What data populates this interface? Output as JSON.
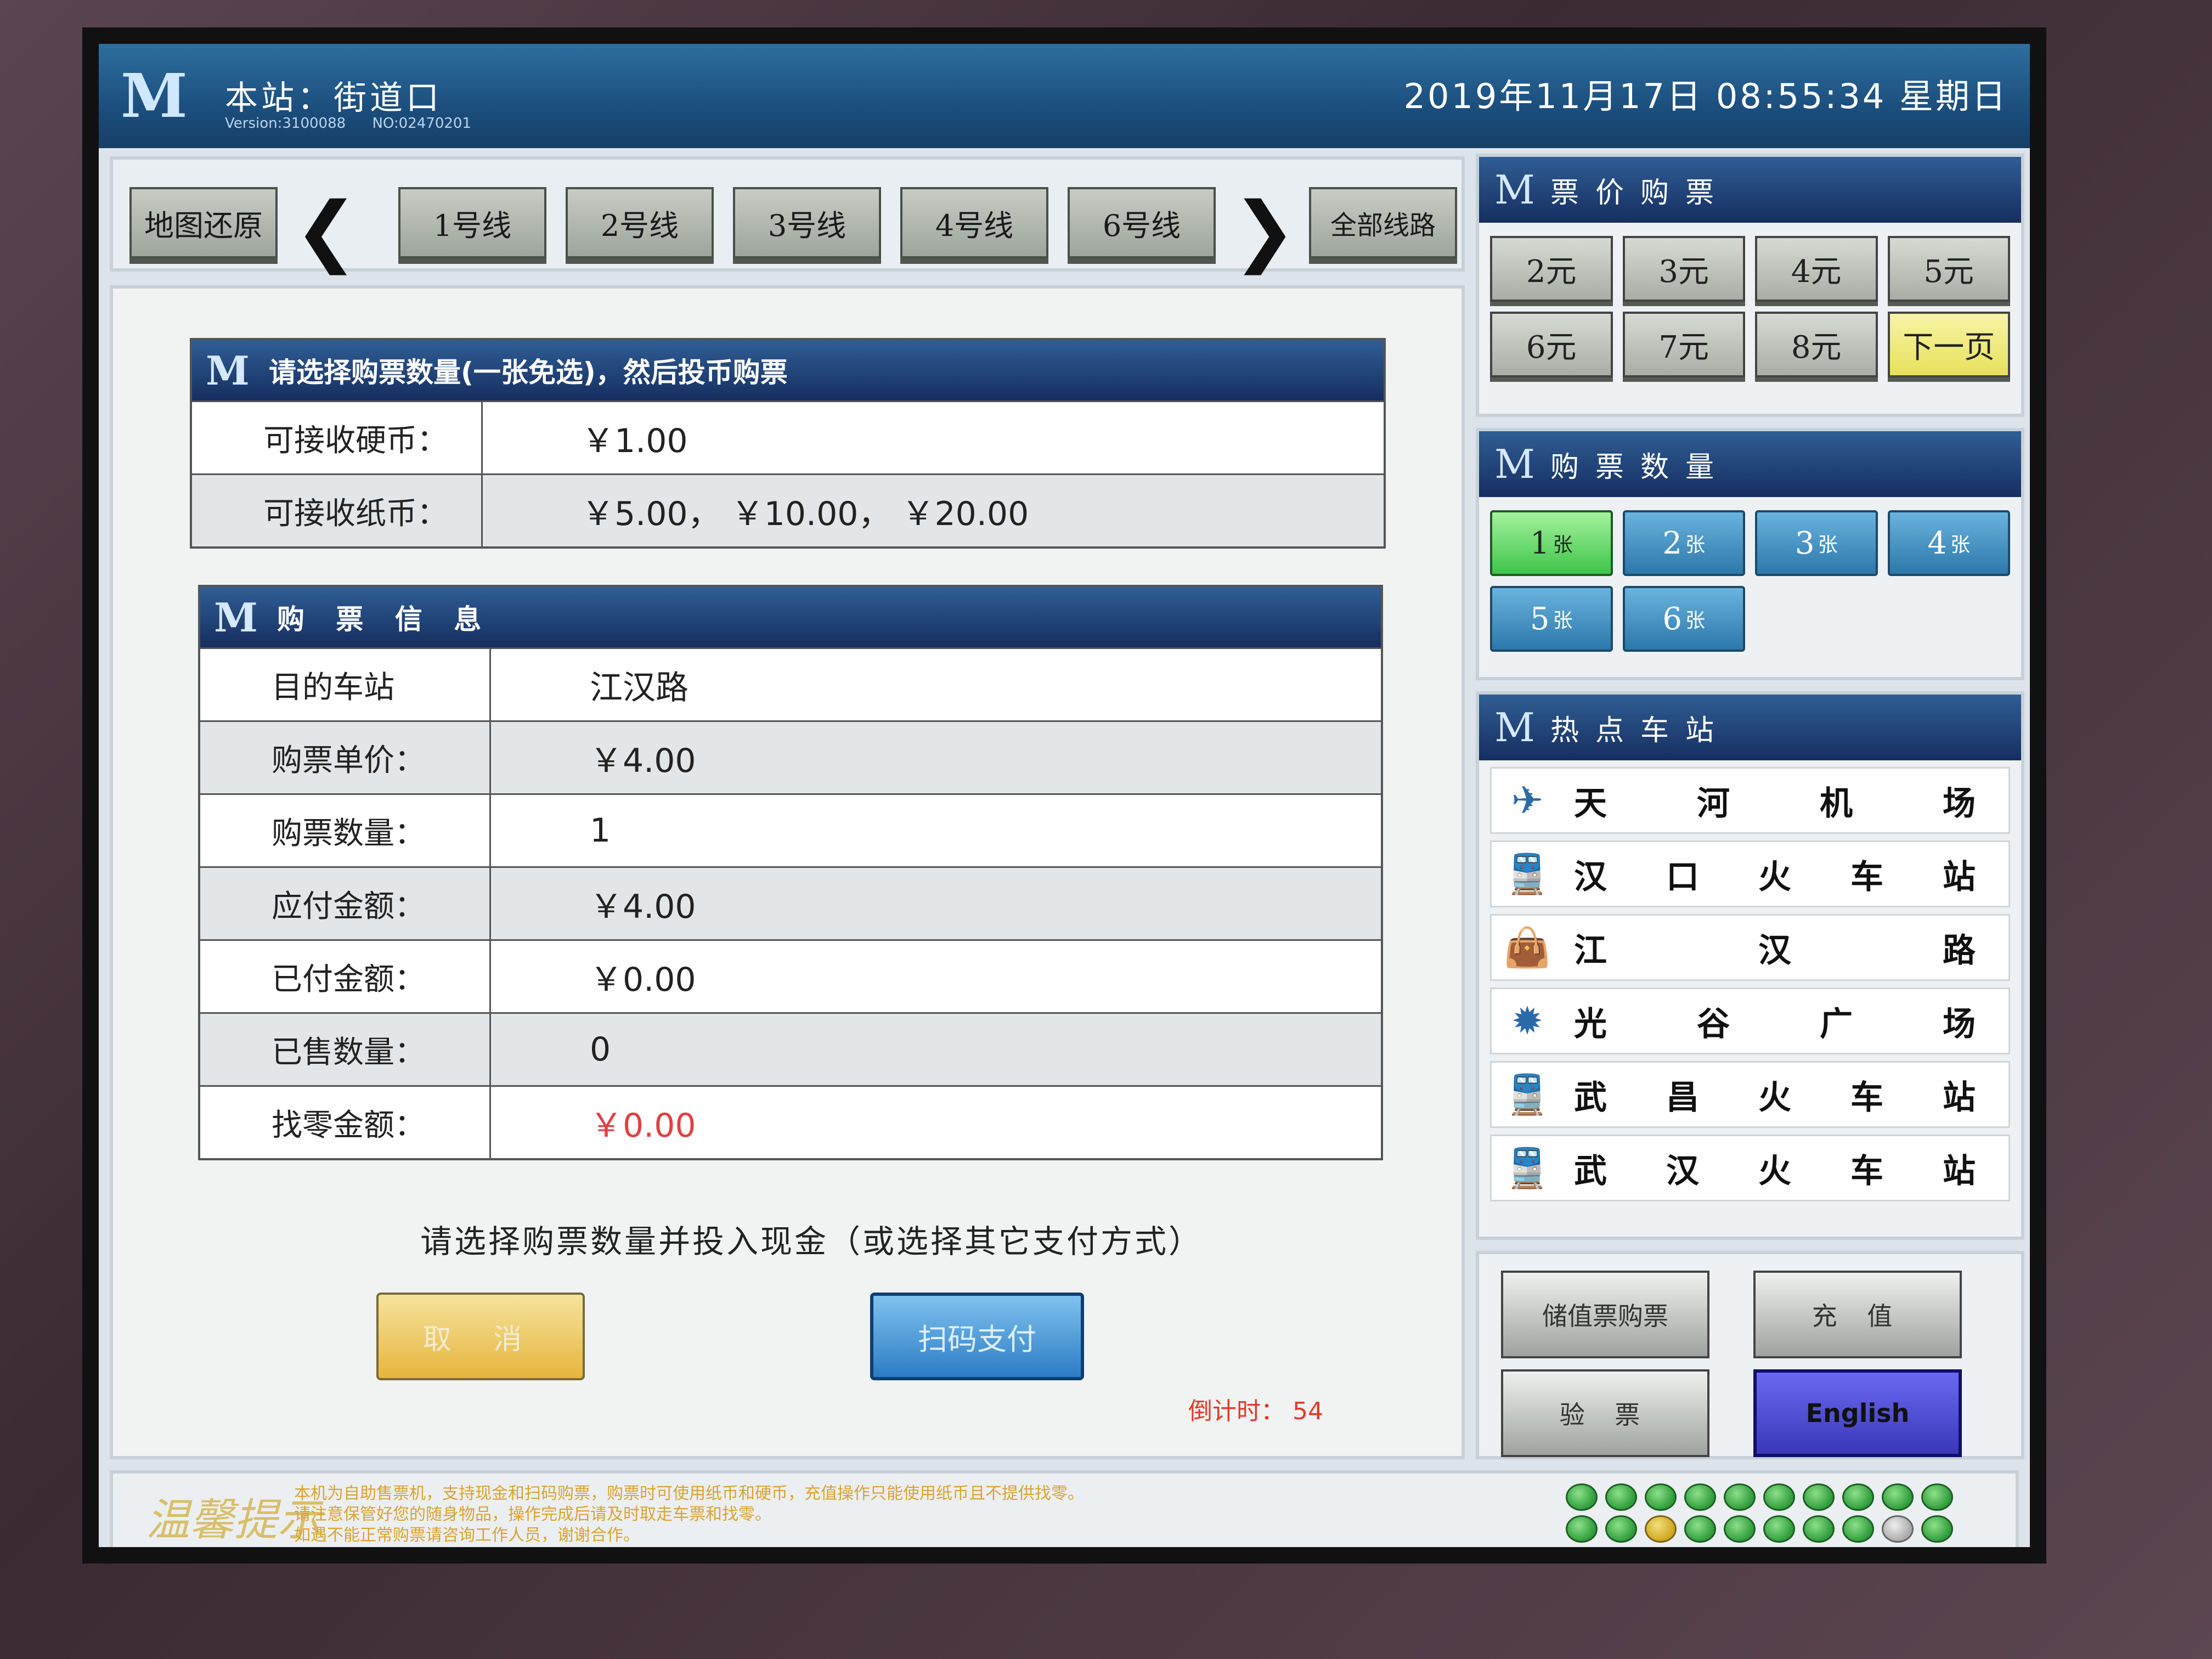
{
  "header": {
    "station_label": "本站：街道口",
    "version": "Version:3100088",
    "machine_no": "NO:02470201",
    "datetime": "2019年11月17日  08:55:34  星期日"
  },
  "linenav": {
    "map_reset": "地图还原",
    "lines": [
      "1号线",
      "2号线",
      "3号线",
      "4号线",
      "6号线"
    ],
    "all_lines": "全部线路"
  },
  "payment_info": {
    "title": "请选择购票数量(一张免选)，然后投币购票",
    "rows": [
      {
        "key": "可接收硬币：",
        "value": "￥1.00"
      },
      {
        "key": "可接收纸币：",
        "value": "￥5.00， ￥10.00， ￥20.00"
      }
    ]
  },
  "ticket_info": {
    "title": "购 票 信 息",
    "rows": [
      {
        "key": "目的车站",
        "value": "江汉路"
      },
      {
        "key": "购票单价：",
        "value": "￥4.00"
      },
      {
        "key": "购票数量：",
        "value": "1"
      },
      {
        "key": "应付金额：",
        "value": "￥4.00"
      },
      {
        "key": "已付金额：",
        "value": "￥0.00"
      },
      {
        "key": "已售数量：",
        "value": "0"
      },
      {
        "key": "找零金额：",
        "value": "￥0.00"
      }
    ]
  },
  "prompt": "请选择购票数量并投入现金（或选择其它支付方式）",
  "actions": {
    "cancel": "取 消",
    "scan_pay": "扫码支付"
  },
  "countdown": {
    "label": "倒计时：",
    "value": "54"
  },
  "price_panel": {
    "title": "票价购票",
    "prices": [
      "2元",
      "3元",
      "4元",
      "5元",
      "6元",
      "7元",
      "8元"
    ],
    "next_page": "下一页"
  },
  "quantity_panel": {
    "title": "购票数量",
    "unit": "张",
    "counts": [
      "1",
      "2",
      "3",
      "4",
      "5",
      "6"
    ],
    "selected": "1"
  },
  "hot_stations": {
    "title": "热点车站",
    "items": [
      {
        "icon": "airplane-icon",
        "name": [
          "天",
          "河",
          "机",
          "场"
        ]
      },
      {
        "icon": "train-icon",
        "name": [
          "汉",
          "口",
          "火",
          "车",
          "站"
        ]
      },
      {
        "icon": "shopping-bag-icon",
        "name": [
          "江",
          "汉",
          "路"
        ]
      },
      {
        "icon": "optical-valley-icon",
        "name": [
          "光",
          "谷",
          "广",
          "场"
        ]
      },
      {
        "icon": "train-icon",
        "name": [
          "武",
          "昌",
          "火",
          "车",
          "站"
        ]
      },
      {
        "icon": "train-icon",
        "name": [
          "武",
          "汉",
          "火",
          "车",
          "站"
        ]
      }
    ]
  },
  "function_buttons": {
    "stored_value": "储值票购票",
    "recharge": "充 值",
    "check_ticket": "验 票",
    "english": "English"
  },
  "notice": {
    "title": "温馨提示",
    "lines": [
      "本机为自助售票机，支持现金和扫码购票，购票时可使用纸币和硬币，充值操作只能使用纸币且不提供找零。",
      "请注意保管好您的随身物品，操作完成后请及时取走车票和找零。",
      "如遇不能正常购票请咨询工作人员，谢谢合作。"
    ]
  },
  "status_lights": {
    "colors": {
      "ok": "#2e9c3a",
      "warn": "#d0a520",
      "off": "#aaaaaa"
    },
    "row1": [
      "ok",
      "ok",
      "ok",
      "ok",
      "ok",
      "ok",
      "ok",
      "ok",
      "ok",
      "ok"
    ],
    "row2": [
      "ok",
      "ok",
      "warn",
      "ok",
      "ok",
      "ok",
      "ok",
      "ok",
      "off",
      "ok"
    ]
  }
}
